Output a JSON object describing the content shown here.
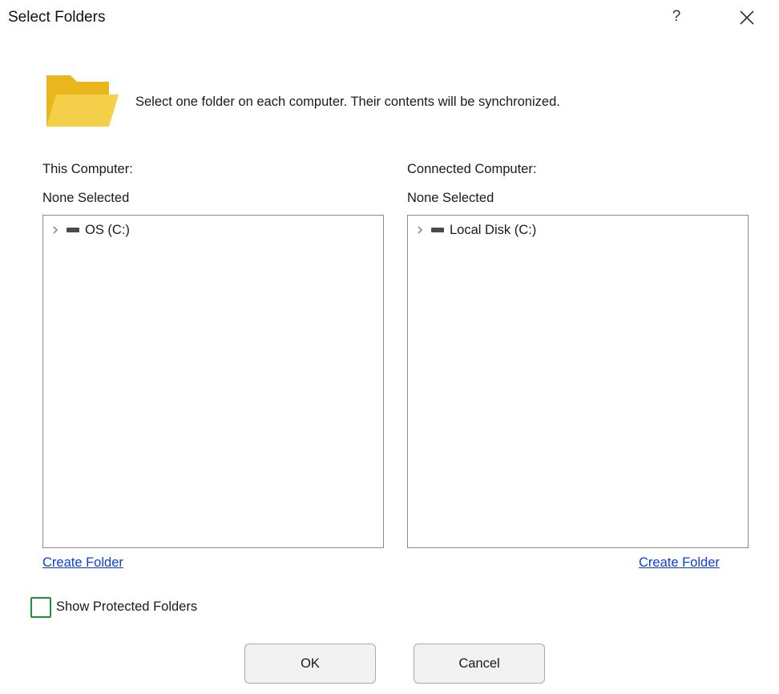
{
  "window": {
    "title": "Select Folders",
    "help_label": "?",
    "close_icon": "close-icon"
  },
  "intro": {
    "icon": "folder-icon",
    "text": "Select one folder on each computer.  Their contents will be synchronized."
  },
  "left_panel": {
    "label": "This Computer:",
    "status": "None Selected",
    "tree": [
      {
        "label": "OS (C:)",
        "icon": "drive-icon",
        "expanded": false
      }
    ],
    "create_folder": "Create Folder"
  },
  "right_panel": {
    "label": "Connected Computer:",
    "status": "None Selected",
    "tree": [
      {
        "label": "Local Disk (C:)",
        "icon": "drive-icon",
        "expanded": false
      }
    ],
    "create_folder": "Create Folder"
  },
  "options": {
    "show_protected_label": "Show Protected Folders",
    "show_protected_checked": false,
    "accent_color": "#1f8f3e"
  },
  "buttons": {
    "ok": "OK",
    "cancel": "Cancel"
  },
  "colors": {
    "link": "#0b3fd9",
    "folder_back": "#e9b61e",
    "folder_front": "#f4cf4a"
  }
}
